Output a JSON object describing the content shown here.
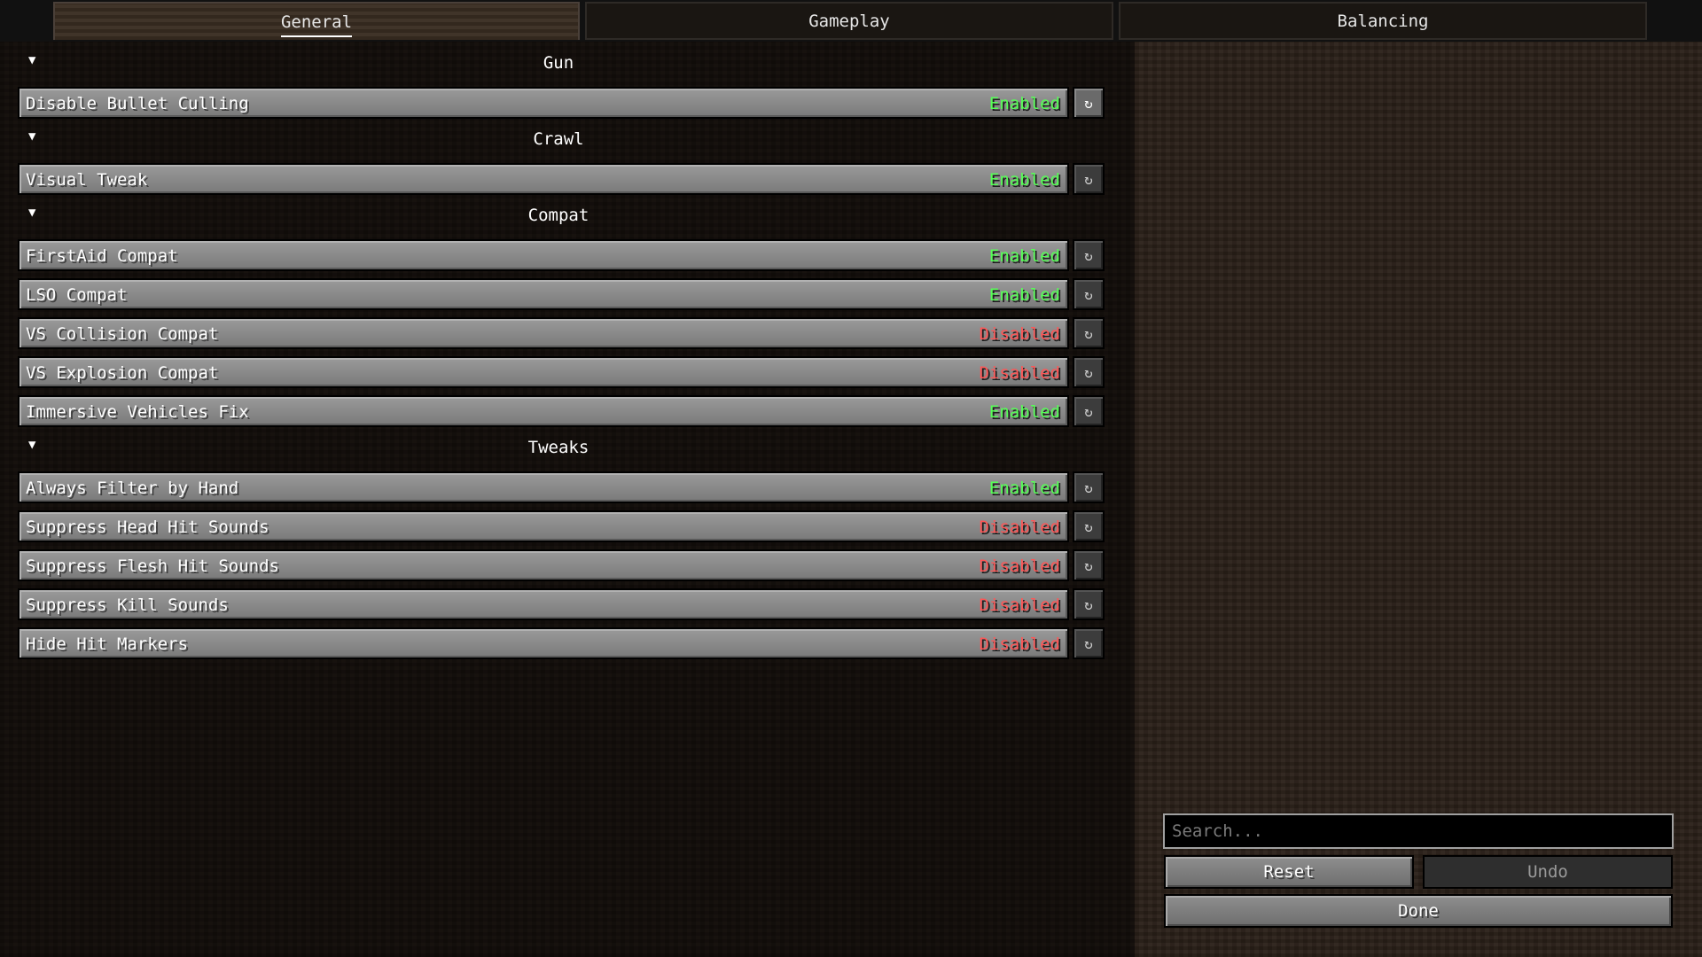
{
  "tabs": [
    {
      "label": "General",
      "active": true
    },
    {
      "label": "Gameplay",
      "active": false
    },
    {
      "label": "Balancing",
      "active": false
    }
  ],
  "colors": {
    "enabled": "#55ff55",
    "disabled": "#ff5555"
  },
  "sections": [
    {
      "title": "Gun",
      "options": [
        {
          "label": "Disable Bullet Culling",
          "value": "Enabled"
        }
      ]
    },
    {
      "title": "Crawl",
      "options": [
        {
          "label": "Visual Tweak",
          "value": "Enabled"
        }
      ]
    },
    {
      "title": "Compat",
      "options": [
        {
          "label": "FirstAid Compat",
          "value": "Enabled"
        },
        {
          "label": "LSO Compat",
          "value": "Enabled"
        },
        {
          "label": "VS Collision Compat",
          "value": "Disabled"
        },
        {
          "label": "VS Explosion Compat",
          "value": "Disabled"
        },
        {
          "label": "Immersive Vehicles Fix",
          "value": "Enabled"
        }
      ]
    },
    {
      "title": "Tweaks",
      "options": [
        {
          "label": "Always Filter by Hand",
          "value": "Enabled"
        },
        {
          "label": "Suppress Head Hit Sounds",
          "value": "Disabled"
        },
        {
          "label": "Suppress Flesh Hit Sounds",
          "value": "Disabled"
        },
        {
          "label": "Suppress Kill Sounds",
          "value": "Disabled"
        },
        {
          "label": "Hide Hit Markers",
          "value": "Disabled"
        }
      ]
    }
  ],
  "icons": {
    "collapse": "triangle-down-icon",
    "reset": "reset-icon"
  },
  "search": {
    "placeholder": "Search..."
  },
  "buttons": {
    "reset": "Reset",
    "undo": "Undo",
    "done": "Done"
  }
}
